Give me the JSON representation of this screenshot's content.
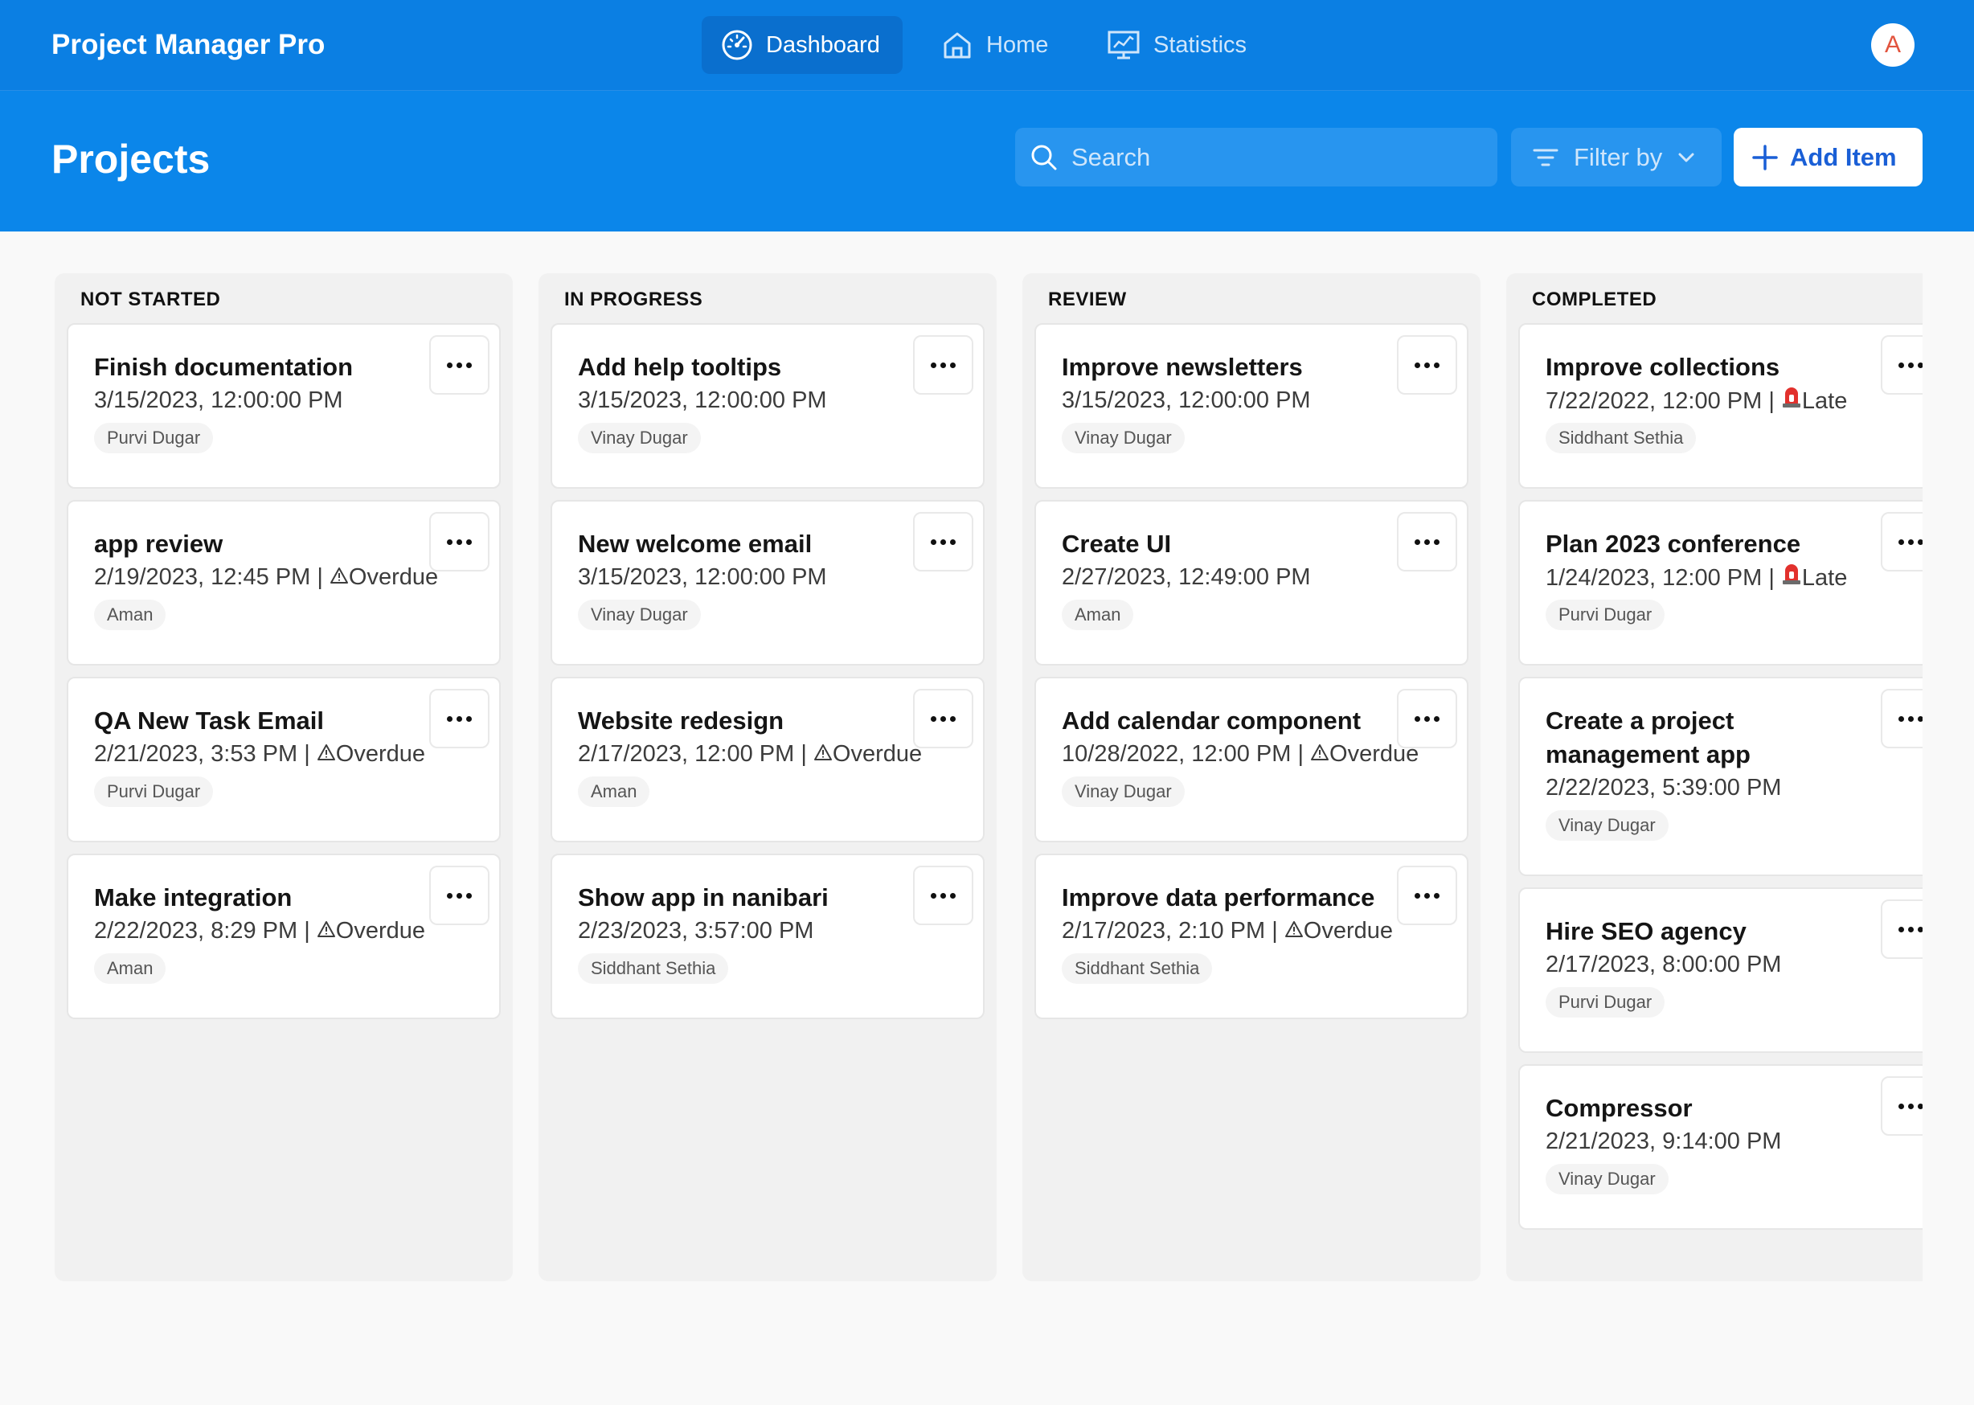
{
  "app_title": "Project Manager Pro",
  "nav": [
    {
      "label": "Dashboard",
      "icon": "gauge-icon",
      "active": true
    },
    {
      "label": "Home",
      "icon": "home-icon",
      "active": false
    },
    {
      "label": "Statistics",
      "icon": "statistics-icon",
      "active": false
    }
  ],
  "user": {
    "initial": "A"
  },
  "page_title": "Projects",
  "search": {
    "placeholder": "Search",
    "value": ""
  },
  "filter": {
    "label": "Filter by"
  },
  "add_button": {
    "label": "Add Item"
  },
  "colors": {
    "header": "#0b7fe3",
    "subheader": "#0b86ea",
    "accent": "#1a5fd6",
    "late": "#e2312d"
  },
  "columns": [
    {
      "title": "NOT STARTED",
      "cards": [
        {
          "title": "Finish documentation",
          "date": "3/15/2023, 12:00:00 PM",
          "status": "",
          "assignee": "Purvi Dugar"
        },
        {
          "title": "app review",
          "date": "2/19/2023, 12:45 PM",
          "status": "Overdue",
          "assignee": "Aman"
        },
        {
          "title": "QA New Task Email",
          "date": "2/21/2023, 3:53 PM",
          "status": "Overdue",
          "assignee": "Purvi Dugar"
        },
        {
          "title": "Make integration",
          "date": "2/22/2023, 8:29 PM",
          "status": "Overdue",
          "assignee": "Aman"
        }
      ]
    },
    {
      "title": "IN PROGRESS",
      "cards": [
        {
          "title": "Add help tooltips",
          "date": "3/15/2023, 12:00:00 PM",
          "status": "",
          "assignee": "Vinay Dugar"
        },
        {
          "title": "New welcome email",
          "date": "3/15/2023, 12:00:00 PM",
          "status": "",
          "assignee": "Vinay Dugar"
        },
        {
          "title": "Website redesign",
          "date": "2/17/2023, 12:00 PM",
          "status": "Overdue",
          "assignee": "Aman"
        },
        {
          "title": "Show app in nanibari",
          "date": "2/23/2023, 3:57:00 PM",
          "status": "",
          "assignee": "Siddhant Sethia"
        }
      ]
    },
    {
      "title": "REVIEW",
      "cards": [
        {
          "title": "Improve newsletters",
          "date": "3/15/2023, 12:00:00 PM",
          "status": "",
          "assignee": "Vinay Dugar"
        },
        {
          "title": "Create UI",
          "date": "2/27/2023, 12:49:00 PM",
          "status": "",
          "assignee": "Aman"
        },
        {
          "title": "Add calendar component",
          "date": "10/28/2022, 12:00 PM",
          "status": "Overdue",
          "assignee": "Vinay Dugar"
        },
        {
          "title": "Improve data performance",
          "date": "2/17/2023, 2:10 PM",
          "status": "Overdue",
          "assignee": "Siddhant Sethia"
        }
      ]
    },
    {
      "title": "COMPLETED",
      "cards": [
        {
          "title": "Improve collections",
          "date": "7/22/2022, 12:00 PM",
          "status": "Late",
          "assignee": "Siddhant Sethia"
        },
        {
          "title": "Plan 2023 conference",
          "date": "1/24/2023, 12:00 PM",
          "status": "Late",
          "assignee": "Purvi Dugar"
        },
        {
          "title": "Create a project management app",
          "date": "2/22/2023, 5:39:00 PM",
          "status": "",
          "assignee": "Vinay Dugar"
        },
        {
          "title": "Hire SEO agency",
          "date": "2/17/2023, 8:00:00 PM",
          "status": "",
          "assignee": "Purvi Dugar"
        },
        {
          "title": "Compressor",
          "date": "2/21/2023, 9:14:00 PM",
          "status": "",
          "assignee": "Vinay Dugar"
        }
      ]
    }
  ]
}
